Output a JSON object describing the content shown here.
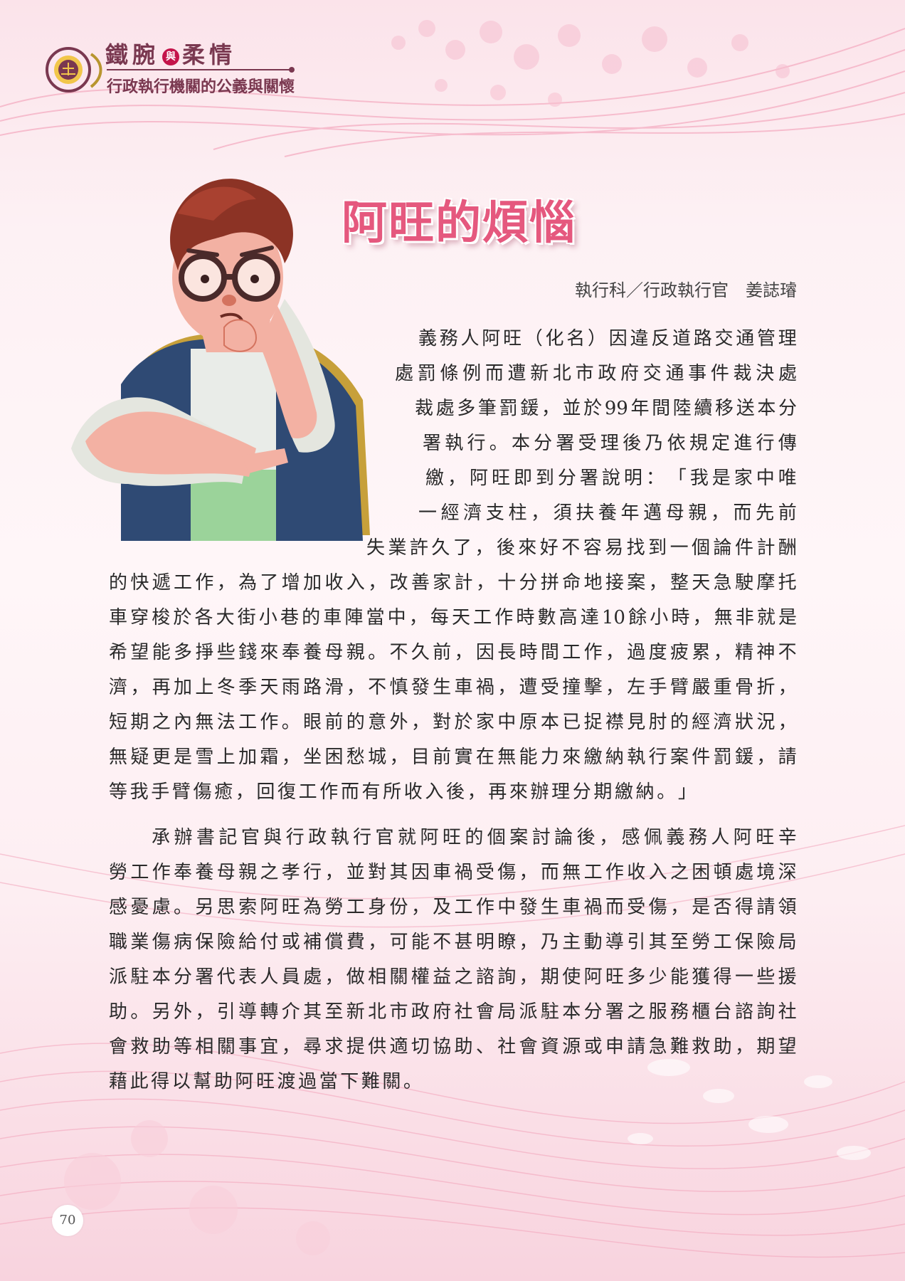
{
  "header": {
    "title_left": "鐵腕",
    "title_mid": "與",
    "title_right": "柔情",
    "subtitle": "行政執行機關的公義與關懷"
  },
  "article": {
    "title": "阿旺的煩惱",
    "byline": "執行科／行政執行官　姜誌璿",
    "lines": [
      "義務人阿旺（化名）因違反道路交通管理",
      "處罰條例而遭新北市政府交通事件裁決處",
      "裁處多筆罰鍰，並於99年間陸續移送本分",
      "署執行。本分署受理後乃依規定進行傳",
      "繳，阿旺即到分署說明：「我是家中唯",
      "一經濟支柱，須扶養年邁母親，而先前",
      "失業許久了，後來好不容易找到一個論件計酬",
      "的快遞工作，為了增加收入，改善家計，十分拼命地接案，整天急駛摩托",
      "車穿梭於各大街小巷的車陣當中，每天工作時數高達10餘小時，無非就是",
      "希望能多掙些錢來奉養母親。不久前，因長時間工作，過度疲累，精神不",
      "濟，再加上冬季天雨路滑，不慎發生車禍，遭受撞擊，左手臂嚴重骨折，",
      "短期之內無法工作。眼前的意外，對於家中原本已捉襟見肘的經濟狀況，",
      "無疑更是雪上加霜，坐困愁城，目前實在無能力來繳納執行案件罰鍰，請",
      "等我手臂傷癒，回復工作而有所收入後，再來辦理分期繳納。」",
      "承辦書記官與行政執行官就阿旺的個案討論後，感佩義務人阿旺辛",
      "勞工作奉養母親之孝行，並對其因車禍受傷，而無工作收入之困頓處境深",
      "感憂慮。另思索阿旺為勞工身份，及工作中發生車禍而受傷，是否得請領",
      "職業傷病保險給付或補償費，可能不甚明瞭，乃主動導引其至勞工保險局",
      "派駐本分署代表人員處，做相關權益之諮詢，期使阿旺多少能獲得一些援",
      "助。另外，引導轉介其至新北市政府社會局派駐本分署之服務櫃台諮詢社",
      "會救助等相關事宜，尋求提供適切協助、社會資源或申請急難救助，期望",
      "藉此得以幫助阿旺渡過當下難關。"
    ]
  },
  "page_number": "70"
}
